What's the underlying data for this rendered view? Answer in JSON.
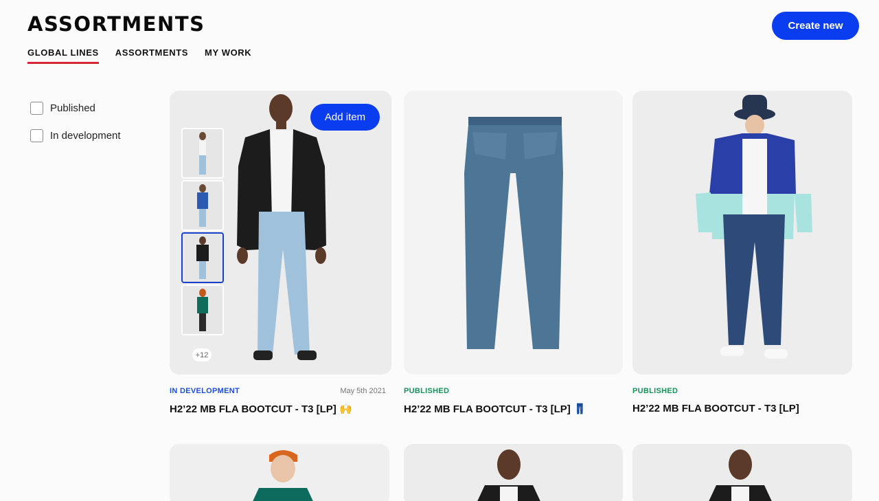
{
  "header": {
    "title": "ASSORTMENTS",
    "create_label": "Create new"
  },
  "tabs": [
    {
      "label": "GLOBAL LINES",
      "active": true
    },
    {
      "label": "ASSORTMENTS",
      "active": false
    },
    {
      "label": "MY WORK",
      "active": false
    }
  ],
  "filters": [
    {
      "label": "Published",
      "checked": false
    },
    {
      "label": "In development",
      "checked": false
    }
  ],
  "cards": [
    {
      "status": "IN DEVELOPMENT",
      "date": "May 5th 2021",
      "title": "H2’22 MB FLA BOOTCUT - T3 [LP] 🙌",
      "add_label": "Add item",
      "more_label": "+12"
    },
    {
      "status": "PUBLISHED",
      "title": "H2’22 MB FLA BOOTCUT - T3 [LP] 👖"
    },
    {
      "status": "PUBLISHED",
      "title": "H2’22 MB FLA BOOTCUT - T3 [LP]"
    }
  ],
  "colors": {
    "accent": "#0a3cf0",
    "tab_underline": "#d8243a",
    "status_dev": "#1a4fd8",
    "status_published": "#14935a"
  }
}
